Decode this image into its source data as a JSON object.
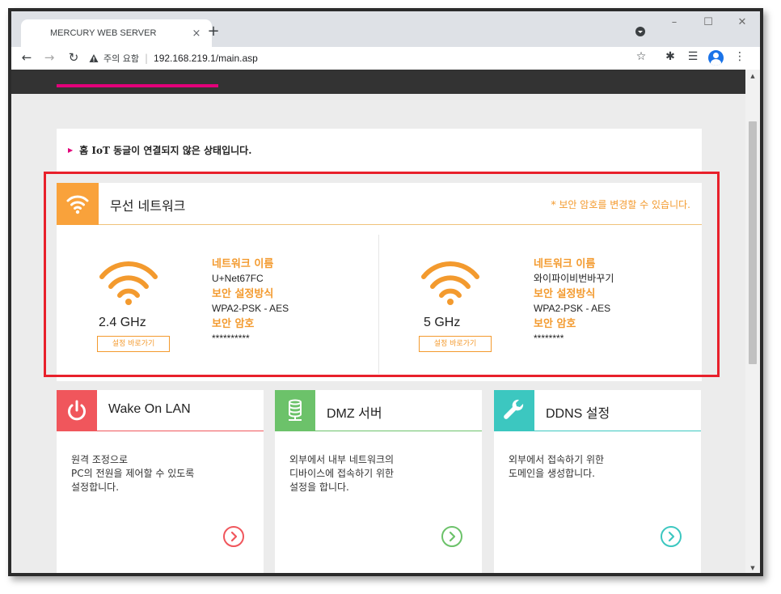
{
  "browser": {
    "tab_title": "MERCURY WEB SERVER",
    "tab_close": "×",
    "new_tab": "+",
    "window_minimize": "–",
    "window_maximize": "☐",
    "window_close": "✕",
    "security_warning_icon": "warning-triangle-icon",
    "security_warning": "주의 요함",
    "url": "192.168.219.1/main.asp",
    "back": "←",
    "forward": "→",
    "reload": "↻",
    "star": "☆",
    "extensions": "✱",
    "reading_list": "☰",
    "menu": "⋮"
  },
  "notice": {
    "arrow": "▶",
    "text": "홈 IoT 동글이 연결되지 않은 상태입니다."
  },
  "wireless": {
    "title": "무선 네트워크",
    "note": "* 보안 암호를 변경할 수 있습니다.",
    "accent_color": "#f9a23b",
    "bands": [
      {
        "band": "2.4 GHz",
        "shortcut": "설정 바로가기",
        "name_label": "네트워크 이름",
        "name": "U+Net67FC",
        "security_label": "보안 설정방식",
        "security": "WPA2-PSK - AES",
        "password_label": "보안 암호",
        "password": "**********"
      },
      {
        "band": "5 GHz",
        "shortcut": "설정 바로가기",
        "name_label": "네트워크 이름",
        "name": "와이파이비번바꾸기",
        "security_label": "보안 설정방식",
        "security": "WPA2-PSK - AES",
        "password_label": "보안 암호",
        "password": "********"
      }
    ]
  },
  "cards": [
    {
      "title": "Wake On LAN",
      "icon": "power-icon",
      "color": "#f0565c",
      "desc": [
        "원격 조정으로",
        "PC의 전원을 제어할 수 있도록",
        "설정합니다."
      ]
    },
    {
      "title": "DMZ 서버",
      "icon": "database-icon",
      "color": "#6cc26a",
      "desc": [
        "외부에서 내부 네트워크의",
        "디바이스에 접속하기 위한",
        "설정을 합니다."
      ]
    },
    {
      "title": "DDNS 설정",
      "icon": "wrench-icon",
      "color": "#3cc7c0",
      "desc": [
        "외부에서 접속하기 위한",
        "도메인을 생성합니다."
      ]
    }
  ]
}
